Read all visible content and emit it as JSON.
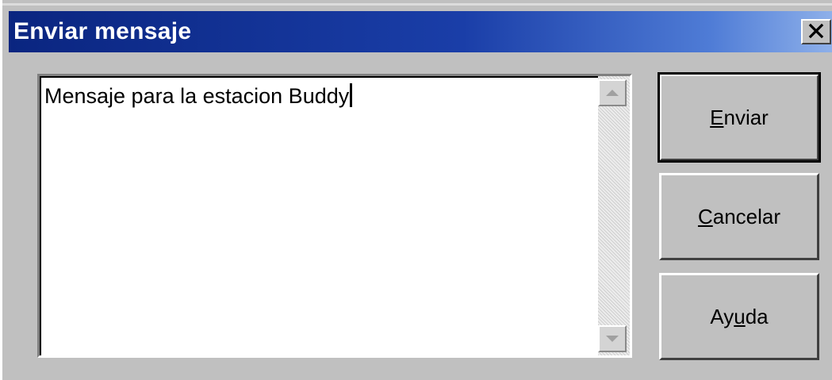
{
  "window": {
    "title": "Enviar mensaje",
    "close_label": "✕"
  },
  "message": {
    "text": "Mensaje para la estacion Buddy"
  },
  "buttons": {
    "send": {
      "before": "",
      "mnemonic": "E",
      "after": "nviar"
    },
    "cancel": {
      "before": "",
      "mnemonic": "C",
      "after": "ancelar"
    },
    "help": {
      "before": "Ay",
      "mnemonic": "u",
      "after": "da"
    }
  },
  "colors": {
    "titlebar_start": "#0a2580",
    "titlebar_end": "#8fb1ea",
    "dialog_face": "#c0c0c0"
  }
}
